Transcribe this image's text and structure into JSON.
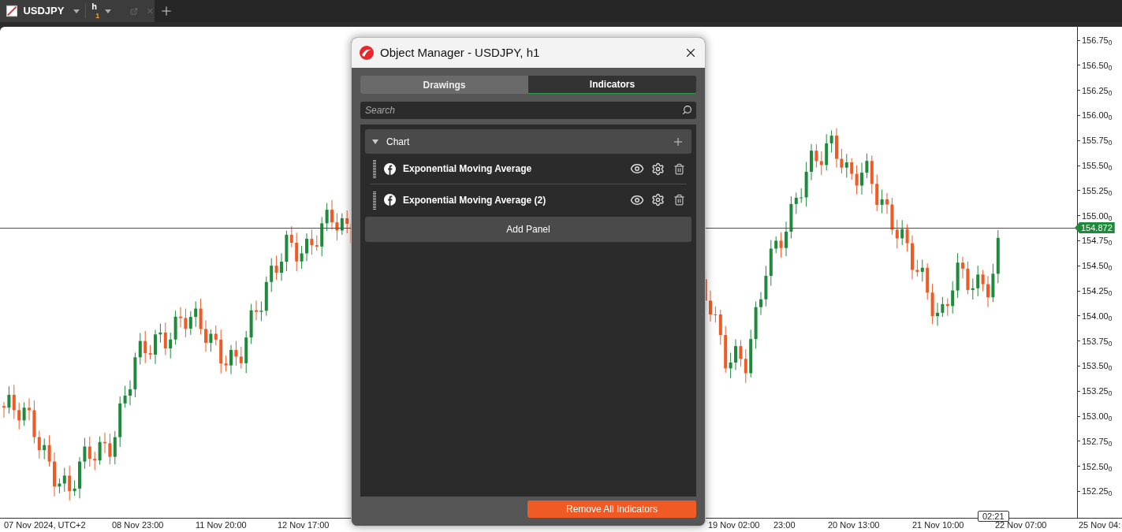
{
  "tab": {
    "symbol": "USDJPY",
    "timeframe": "h",
    "timeframe_sub": "1"
  },
  "chart": {
    "price_labels": [
      "156.75$_{0}$",
      "156.50$_{0}$",
      "156.25$_{0}$",
      "156.00$_{0}$",
      "155.75$_{0}$",
      "155.50$_{0}$",
      "155.25$_{0}$",
      "155.00$_{0}$",
      "154.75$_{0}$",
      "154.50$_{0}$",
      "154.25$_{0}$",
      "154.00$_{0}$",
      "153.75$_{0}$",
      "153.50$_{0}$",
      "153.25$_{0}$",
      "153.00$_{0}$",
      "152.75$_{0}$",
      "152.50$_{0}$",
      "152.25$_{0}$"
    ],
    "time_labels": [
      "07 Nov 2024, UTC+2",
      "08 Nov 23:00",
      "11 Nov 20:00",
      "12 Nov 17:00",
      "19 Nov 02:00",
      "23:00",
      "20 Nov 13:00",
      "21 Nov 10:00",
      "22 Nov 07:00",
      "25 Nov 04:"
    ],
    "current_price": "154.872",
    "time_badge": "02:21"
  },
  "dialog": {
    "title": "Object Manager - USDJPY, h1",
    "tabs": [
      {
        "label": "Drawings",
        "selected": false
      },
      {
        "label": "Indicators",
        "selected": true
      }
    ],
    "search": {
      "placeholder": "Search"
    },
    "groups": [
      {
        "name": "Chart",
        "expanded": true,
        "items": [
          {
            "name": "Exponential Moving Average"
          },
          {
            "name": "Exponential Moving Average (2)"
          }
        ]
      }
    ],
    "add_panel": "Add Panel",
    "remove_all": "Remove All Indicators"
  }
}
